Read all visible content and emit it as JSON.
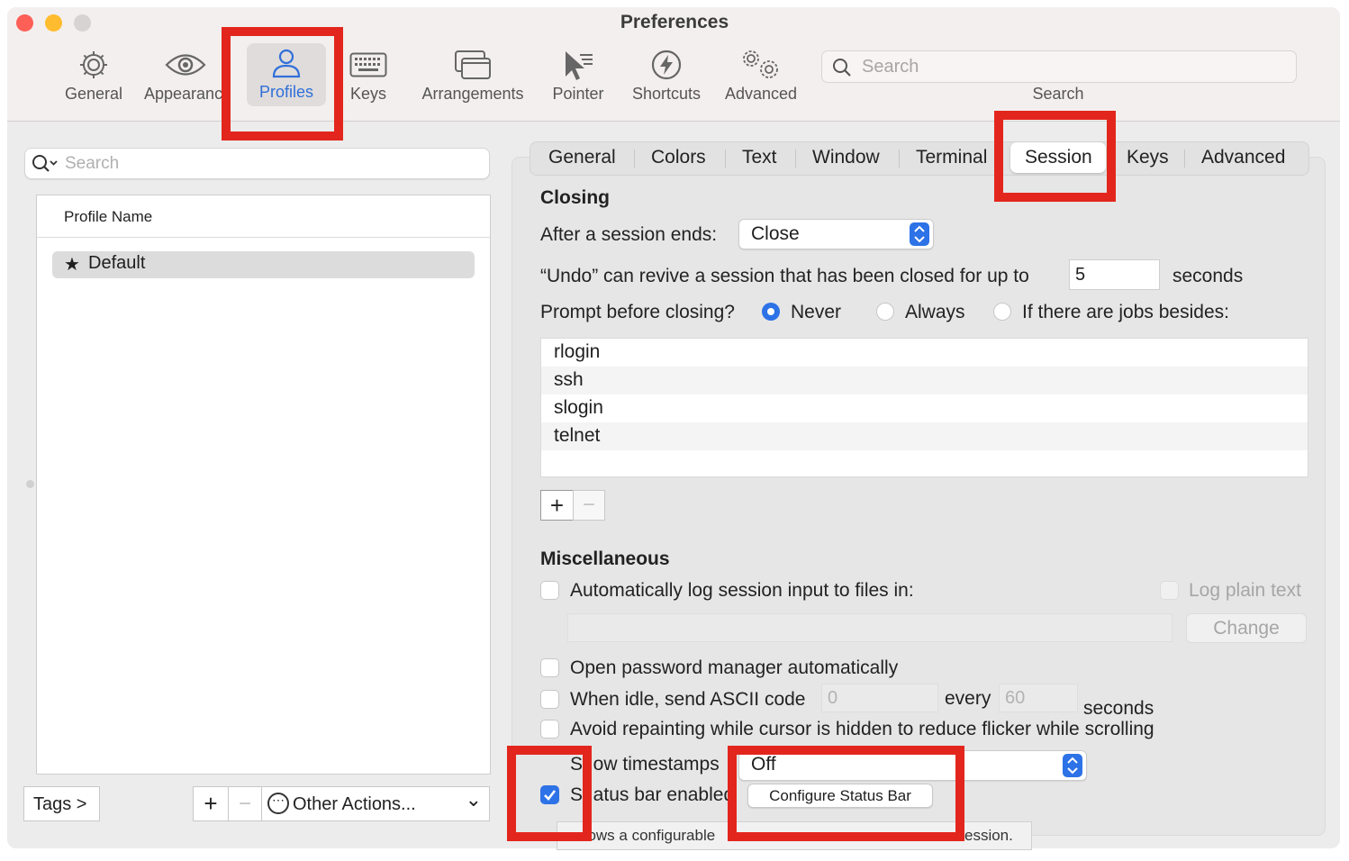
{
  "window": {
    "title": "Preferences",
    "colors": {
      "close": "#fe5f57",
      "minimize": "#febc2e",
      "zoom": "#d7d3d2",
      "accent": "#2d72e6",
      "highlight": "#e3261d"
    }
  },
  "toolbar": {
    "items": [
      {
        "label": "General",
        "icon": "gear-icon"
      },
      {
        "label": "Appearanc",
        "icon": "eye-icon"
      },
      {
        "label": "Profiles",
        "icon": "person-icon"
      },
      {
        "label": "Keys",
        "icon": "keyboard-icon"
      },
      {
        "label": "Arrangements",
        "icon": "windows-icon"
      },
      {
        "label": "Pointer",
        "icon": "pointer-icon"
      },
      {
        "label": "Shortcuts",
        "icon": "bolt-icon"
      },
      {
        "label": "Advanced",
        "icon": "gears-icon"
      }
    ],
    "search_placeholder": "Search",
    "search_label": "Search"
  },
  "sidebar": {
    "search_placeholder": "Search",
    "column_header": "Profile Name",
    "profiles": [
      {
        "star": "★",
        "name": "Default"
      }
    ],
    "tags_button": "Tags >",
    "add": "+",
    "remove": "−",
    "other_actions": "Other Actions...",
    "other_actions_chevron": "⌄",
    "other_actions_icon": "⋯"
  },
  "tabs": [
    "General",
    "Colors",
    "Text",
    "Window",
    "Terminal",
    "Session",
    "Keys",
    "Advanced"
  ],
  "closing": {
    "heading": "Closing",
    "after_label": "After a session ends:",
    "after_value": "Close",
    "undo_label": "“Undo” can revive a session that has been closed for up to",
    "undo_value": "5",
    "undo_unit": "seconds",
    "prompt_label": "Prompt before closing?",
    "options": [
      "Never",
      "Always",
      "If there are jobs besides:"
    ],
    "jobs": [
      "rlogin",
      "ssh",
      "slogin",
      "telnet"
    ],
    "add": "+",
    "remove": "−"
  },
  "misc": {
    "heading": "Miscellaneous",
    "log_label": "Automatically log session input to files in:",
    "log_plain": "Log plain text",
    "change": "Change",
    "password_label": "Open password manager automatically",
    "idle_label": "When idle, send ASCII code",
    "idle_code": "0",
    "every": "every",
    "idle_seconds": "60",
    "seconds": "seconds",
    "avoid_label": "Avoid repainting while cursor is hidden to reduce flicker while scrolling",
    "timestamps_label": "S  ow timestamps",
    "timestamps_value": "Off",
    "status_label": "S  atus bar enabled",
    "configure": "Configure Status Bar",
    "tooltip_left": "  ows a configurable",
    "tooltip_right": "ession."
  }
}
